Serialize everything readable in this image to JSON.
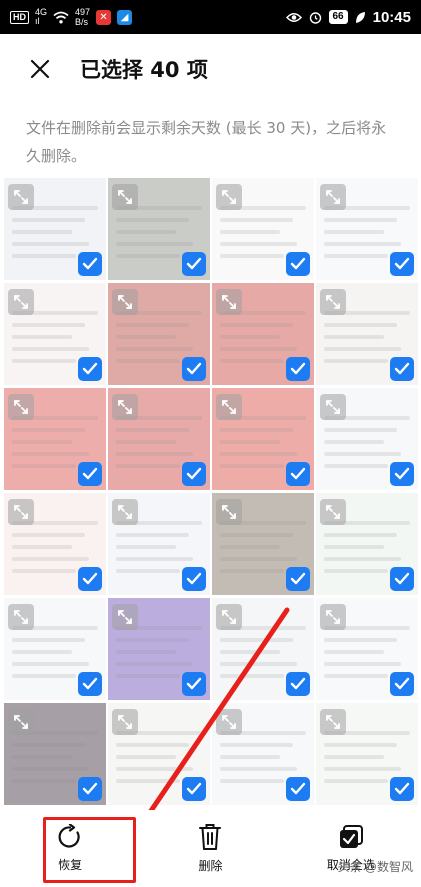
{
  "status_bar": {
    "hd": "HD",
    "net_gen": "4G",
    "net_bars": "ıl",
    "speed_value": "497",
    "speed_unit": "B/s",
    "battery": "66",
    "time": "10:45",
    "colors": {
      "app1": "#e53935",
      "app2": "#1e88e5"
    }
  },
  "header": {
    "close_icon": "close-icon",
    "title": "已选择 40 项"
  },
  "notice": "文件在删除前会显示剩余天数 (最长 30 天)，之后将永久删除。",
  "grid": {
    "accent": "#1e7cf2",
    "tiles": [
      {
        "bg": "#dfe4ea"
      },
      {
        "bg": "#8b8e86"
      },
      {
        "bg": "#f2f2f2"
      },
      {
        "bg": "#eef1f6"
      },
      {
        "bg": "#f0e6e6"
      },
      {
        "bg": "#b8423a"
      },
      {
        "bg": "#c9413b"
      },
      {
        "bg": "#ece6e4"
      },
      {
        "bg": "#d84a44"
      },
      {
        "bg": "#c94340"
      },
      {
        "bg": "#d9483f"
      },
      {
        "bg": "#eceff3"
      },
      {
        "bg": "#f3e3dd"
      },
      {
        "bg": "#e9ecf2"
      },
      {
        "bg": "#7b6c5a"
      },
      {
        "bg": "#e4eee4"
      },
      {
        "bg": "#eef0f3"
      },
      {
        "bg": "#6b4ab8"
      },
      {
        "bg": "#e8ebef"
      },
      {
        "bg": "#eef2f6"
      },
      {
        "bg": "#3a2a3a"
      },
      {
        "bg": "#eceae6"
      },
      {
        "bg": "#eef0f4"
      },
      {
        "bg": "#eaf0ea"
      }
    ]
  },
  "bottom_bar": {
    "restore_label": "恢复",
    "delete_label": "删除",
    "deselect_label": "取消全选"
  },
  "watermark": "头条 @数智风",
  "annotation_color": "#e8201c"
}
